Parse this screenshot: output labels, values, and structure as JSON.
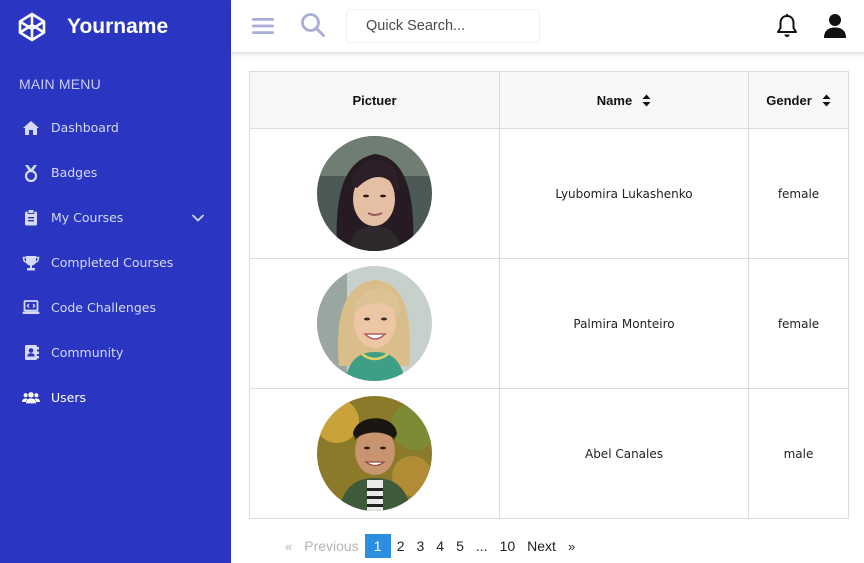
{
  "brand": {
    "name": "Yourname",
    "logo_icon": "codepen-cube-icon"
  },
  "sidebar": {
    "section_title": "MAIN MENU",
    "items": [
      {
        "label": "Dashboard",
        "icon": "home-icon"
      },
      {
        "label": "Badges",
        "icon": "medal-icon"
      },
      {
        "label": "My Courses",
        "icon": "clipboard-icon",
        "has_submenu": true
      },
      {
        "label": "Completed Courses",
        "icon": "trophy-icon"
      },
      {
        "label": "Code Challenges",
        "icon": "laptop-code-icon"
      },
      {
        "label": "Community",
        "icon": "address-book-icon"
      },
      {
        "label": "Users",
        "icon": "users-icon",
        "active": true
      }
    ]
  },
  "topbar": {
    "search_placeholder": "Quick Search...",
    "icons": [
      "menu-icon",
      "search-icon",
      "bell-icon",
      "user-icon"
    ]
  },
  "table": {
    "headers": {
      "picture": "Pictuer",
      "name": "Name",
      "gender": "Gender"
    },
    "rows": [
      {
        "name": "Lyubomira Lukashenko",
        "gender": "female"
      },
      {
        "name": "Palmira Monteiro",
        "gender": "female"
      },
      {
        "name": "Abel Canales",
        "gender": "male"
      }
    ]
  },
  "pagination": {
    "prev_symbol": "«",
    "prev_label": "Previous",
    "pages": [
      "1",
      "2",
      "3",
      "4",
      "5",
      "...",
      "10"
    ],
    "current": "1",
    "next_label": "Next",
    "next_symbol": "»"
  },
  "colors": {
    "sidebar_bg": "#2a36c1",
    "accent": "#2a8fe0",
    "topbar_icon": "#a9add8"
  }
}
